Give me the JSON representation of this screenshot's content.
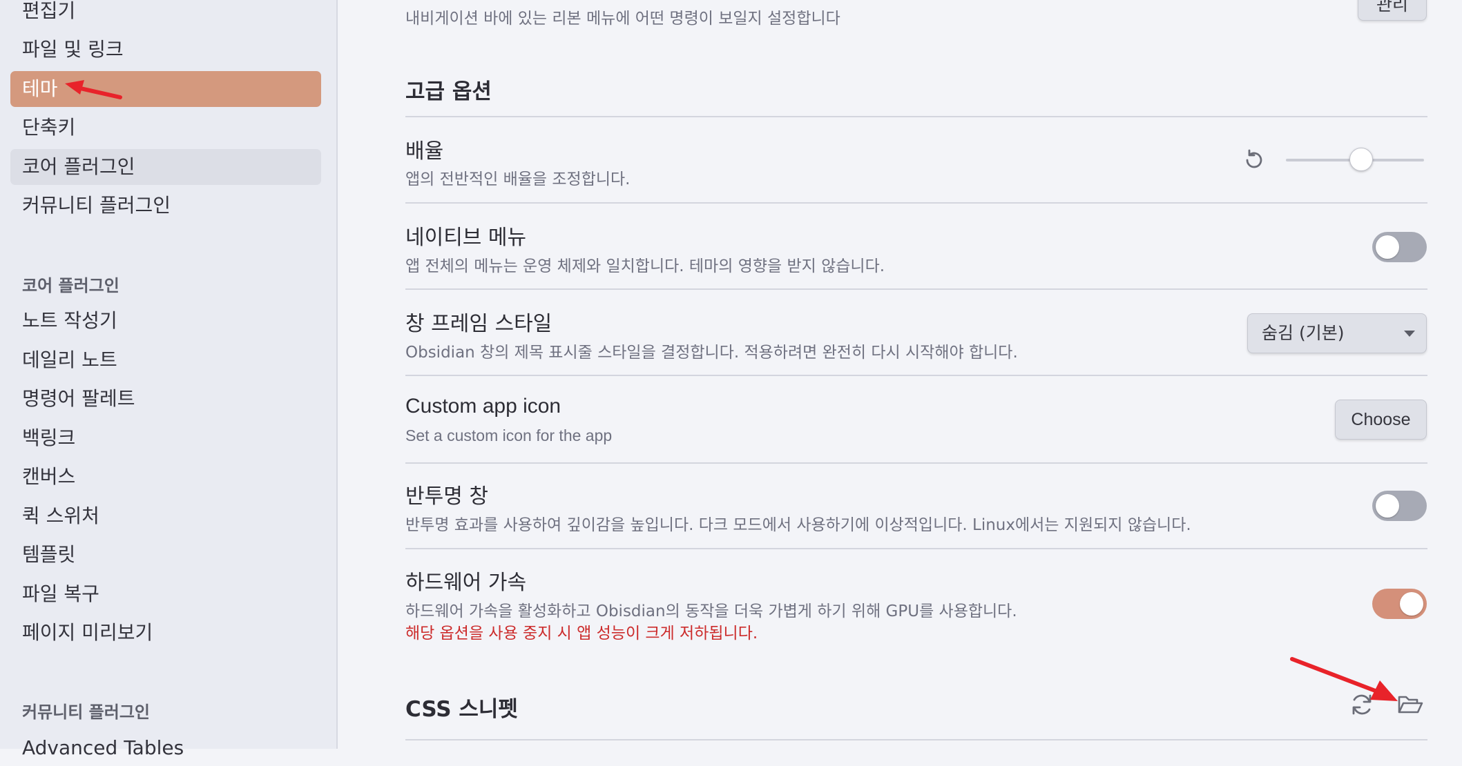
{
  "sidebar": {
    "options_items": [
      {
        "label": "편집기"
      },
      {
        "label": "파일 및 링크"
      },
      {
        "label": "테마"
      },
      {
        "label": "단축키"
      },
      {
        "label": "코어 플러그인"
      },
      {
        "label": "커뮤니티 플러그인"
      }
    ],
    "core_header": "코어 플러그인",
    "core_items": [
      {
        "label": "노트 작성기"
      },
      {
        "label": "데일리 노트"
      },
      {
        "label": "명령어 팔레트"
      },
      {
        "label": "백링크"
      },
      {
        "label": "캔버스"
      },
      {
        "label": "퀵 스위처"
      },
      {
        "label": "템플릿"
      },
      {
        "label": "파일 복구"
      },
      {
        "label": "페이지 미리보기"
      }
    ],
    "community_header": "커뮤니티 플러그인",
    "community_items": [
      {
        "label": "Advanced Tables"
      }
    ]
  },
  "main": {
    "ribbon_desc": "내비게이션 바에 있는 리본 메뉴에 어떤 명령이 보일지 설정합니다",
    "ribbon_button": "관리",
    "advanced_title": "고급 옵션",
    "zoom": {
      "name": "배율",
      "desc": "앱의 전반적인 배율을 조정합니다.",
      "level": 0.5
    },
    "native_menu": {
      "name": "네이티브 메뉴",
      "desc": "앱 전체의 메뉴는 운영 체제와 일치합니다. 테마의 영향을 받지 않습니다.",
      "enabled": false
    },
    "frame_style": {
      "name": "창 프레임 스타일",
      "desc": "Obsidian 창의 제목 표시줄 스타일을 결정합니다. 적용하려면 완전히 다시 시작해야 합니다.",
      "selected": "숨김 (기본)"
    },
    "custom_icon": {
      "name": "Custom app icon",
      "desc": "Set a custom icon for the app",
      "button": "Choose"
    },
    "translucent": {
      "name": "반투명 창",
      "desc": "반투명 효과를 사용하여 깊이감을 높입니다. 다크 모드에서 사용하기에 이상적입니다. Linux에서는 지원되지 않습니다.",
      "enabled": false
    },
    "hw_accel": {
      "name": "하드웨어 가속",
      "desc": "하드웨어 가속을 활성화하고 Obisdian의 동작을 더욱 가볍게 하기 위해 GPU를 사용합니다.",
      "warning": "해당 옵션을 사용 중지 시 앱 성능이 크게 저하됩니다.",
      "enabled": true
    },
    "css_title": "CSS 스니펫"
  },
  "colors": {
    "accent": "#d4997e",
    "warning": "#cc2b2b",
    "arrow": "#e8232a"
  },
  "icons": [
    "reset-icon",
    "slider-handle",
    "dropdown-chevron-icon",
    "reload-icon",
    "folder-open-icon",
    "red-arrow-annotation"
  ]
}
